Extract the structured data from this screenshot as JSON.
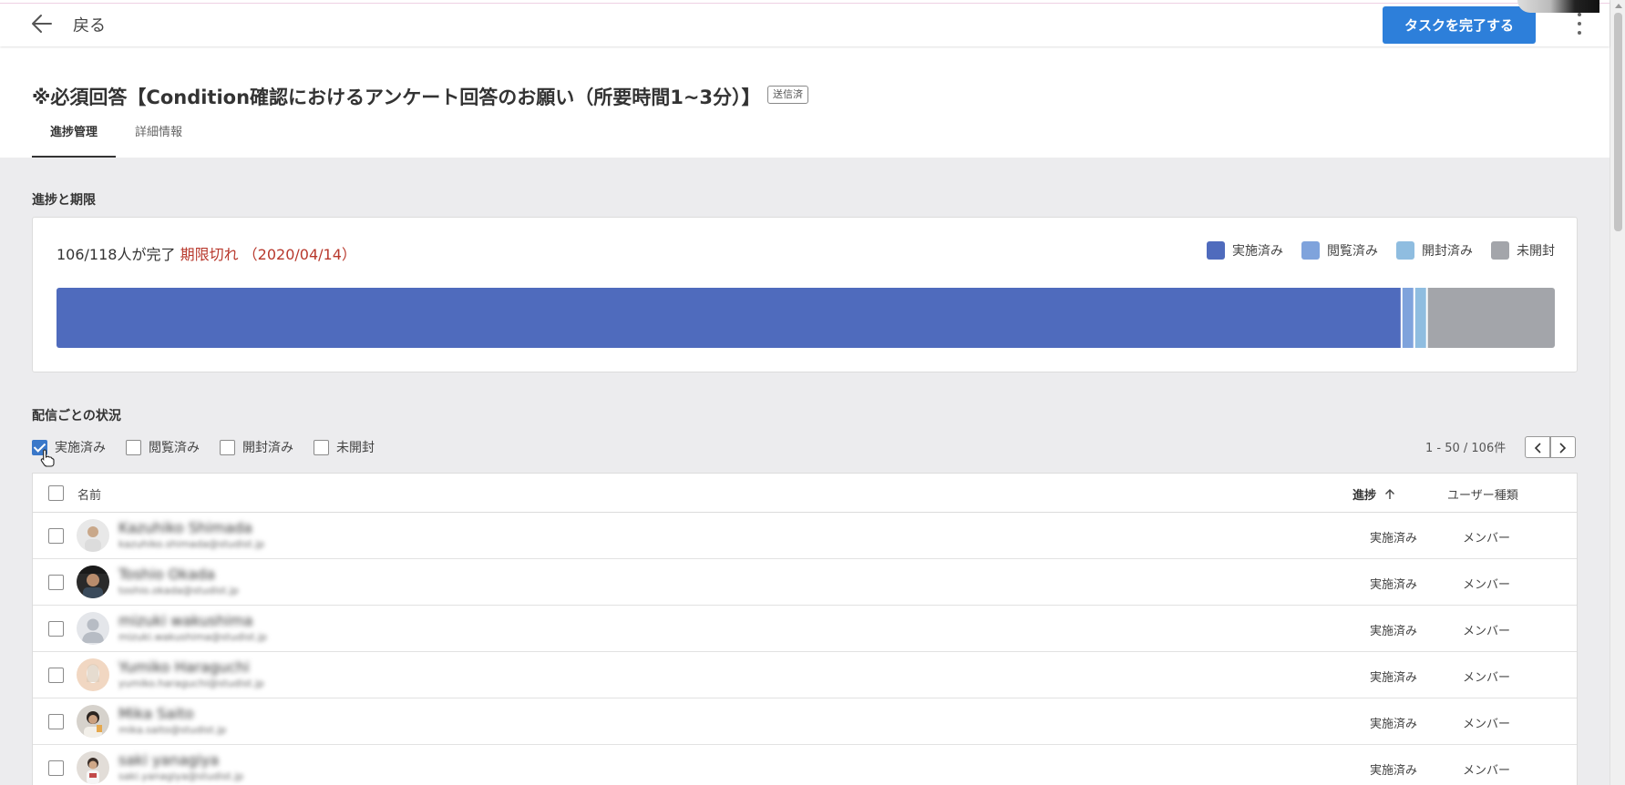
{
  "header": {
    "back_label": "戻る",
    "complete_button": "タスクを完了する"
  },
  "page": {
    "title": "※必須回答【Condition確認におけるアンケート回答のお願い（所要時間1~3分）】",
    "sent_badge": "送信済",
    "tabs": [
      {
        "label": "進捗管理",
        "active": true
      },
      {
        "label": "詳細情報",
        "active": false
      }
    ]
  },
  "progress": {
    "section_title": "進捗と期限",
    "summary": "106/118人が完了",
    "deadline": "期限切れ （2020/04/14）",
    "legend": [
      {
        "label": "実施済み",
        "color": "#4f6bbd"
      },
      {
        "label": "閲覧済み",
        "color": "#7fa3dc"
      },
      {
        "label": "開封済み",
        "color": "#8fbde0"
      },
      {
        "label": "未開封",
        "color": "#a3a5aa"
      }
    ],
    "segments": [
      {
        "status": "実施済み",
        "count": 106,
        "color": "#4f6bbd"
      },
      {
        "status": "閲覧済み",
        "count": 1,
        "color": "#7fa3dc"
      },
      {
        "status": "開封済み",
        "count": 1,
        "color": "#8fbde0"
      },
      {
        "status": "未開封",
        "count": 10,
        "color": "#a3a5aa"
      }
    ],
    "total": 118
  },
  "deliveries": {
    "section_title": "配信ごとの状況",
    "filters": [
      {
        "label": "実施済み",
        "checked": true
      },
      {
        "label": "閲覧済み",
        "checked": false
      },
      {
        "label": "開封済み",
        "checked": false
      },
      {
        "label": "未開封",
        "checked": false
      }
    ],
    "pagination": "1 - 50 / 106件",
    "columns": {
      "name": "名前",
      "progress": "進捗",
      "user_type": "ユーザー種類"
    },
    "rows": [
      {
        "name": "Kazuhiko Shimada",
        "email": "kazuhiko.shimada@studist.jp",
        "status": "実施済み",
        "type": "メンバー"
      },
      {
        "name": "Toshio Okada",
        "email": "toshio.okada@studist.jp",
        "status": "実施済み",
        "type": "メンバー"
      },
      {
        "name": "mizuki wakushima",
        "email": "mizuki.wakushima@studist.jp",
        "status": "実施済み",
        "type": "メンバー"
      },
      {
        "name": "Yumiko Haraguchi",
        "email": "yumiko.haraguchi@studist.jp",
        "status": "実施済み",
        "type": "メンバー"
      },
      {
        "name": "Mika Saito",
        "email": "mika.saito@studist.jp",
        "status": "実施済み",
        "type": "メンバー"
      },
      {
        "name": "saki yanagiya",
        "email": "saki.yanagiya@studist.jp",
        "status": "実施済み",
        "type": "メンバー"
      }
    ]
  }
}
